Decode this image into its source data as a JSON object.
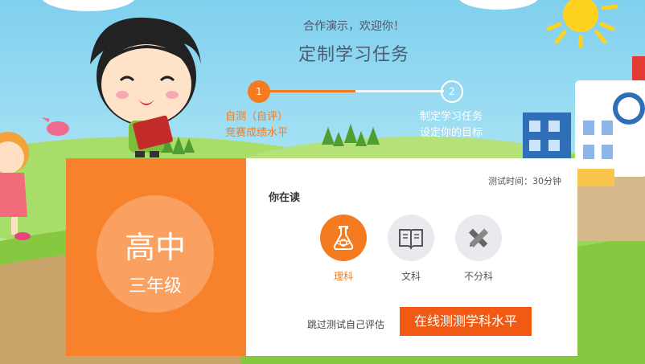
{
  "header": {
    "greeting": "合作演示，欢迎你！",
    "title": "定制学习任务"
  },
  "steps": [
    {
      "number": "1",
      "line1": "自测（自评）",
      "line2": "竞赛成绩水平"
    },
    {
      "number": "2",
      "line1": "制定学习任务",
      "line2": "设定你的目标"
    }
  ],
  "grade": {
    "level": "高中",
    "year": "三年级"
  },
  "panel": {
    "timer": "测试时间：30分钟",
    "reading_label": "你在读",
    "subjects": [
      {
        "label": "理科",
        "icon": "flask-icon",
        "selected": true
      },
      {
        "label": "文科",
        "icon": "book-icon",
        "selected": false
      },
      {
        "label": "不分科",
        "icon": "ruler-pencil-icon",
        "selected": false
      }
    ],
    "skip_link": "跳过测试自己评估",
    "test_button": "在线测测学科水平"
  },
  "colors": {
    "accent": "#f57b20",
    "button": "#f05a13",
    "sky": "#7fd0ee",
    "grass": "#8fcf4b"
  }
}
